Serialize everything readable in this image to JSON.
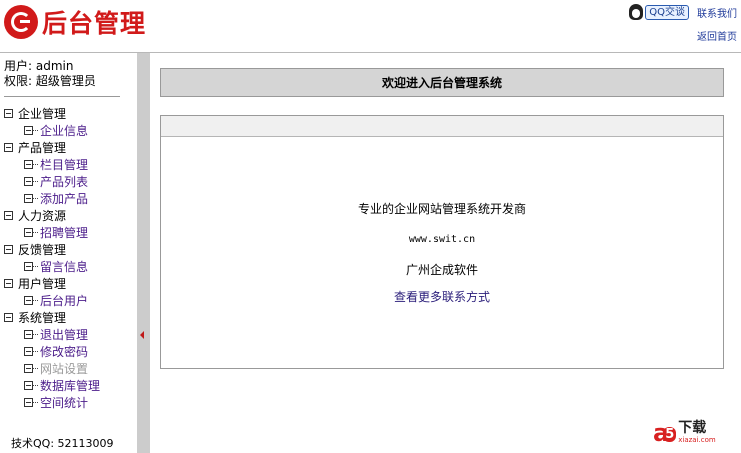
{
  "header": {
    "logo_text": "后台管理",
    "qq_label": "QQ交谈",
    "contact_label": "联系我们",
    "home_label": "返回首页"
  },
  "user": {
    "user_line": "用户: admin",
    "role_line": "权限: 超级管理员"
  },
  "menu": [
    {
      "title": "企业管理",
      "items": [
        "企业信息"
      ]
    },
    {
      "title": "产品管理",
      "items": [
        "栏目管理",
        "产品列表",
        "添加产品"
      ]
    },
    {
      "title": "人力资源",
      "items": [
        "招聘管理"
      ]
    },
    {
      "title": "反馈管理",
      "items": [
        "留言信息"
      ]
    },
    {
      "title": "用户管理",
      "items": [
        "后台用户"
      ]
    },
    {
      "title": "系统管理",
      "items": [
        "退出管理",
        "修改密码",
        "网站设置",
        "数据库管理",
        "空间统计"
      ]
    }
  ],
  "support": "技术QQ: 52113009",
  "main": {
    "title": "欢迎进入后台管理系统",
    "line1": "专业的企业网站管理系统开发商",
    "line2": "www.swit.cn",
    "line3": "广州企成软件",
    "line4": "查看更多联系方式"
  },
  "watermark": {
    "a": "a",
    "five": "5",
    "xz": "下载",
    "url": "xiazai.com"
  },
  "colors": {
    "brand_red": "#d11a1a",
    "menu_link": "#4b1c8a",
    "title_bar": "#d5d5d5"
  }
}
